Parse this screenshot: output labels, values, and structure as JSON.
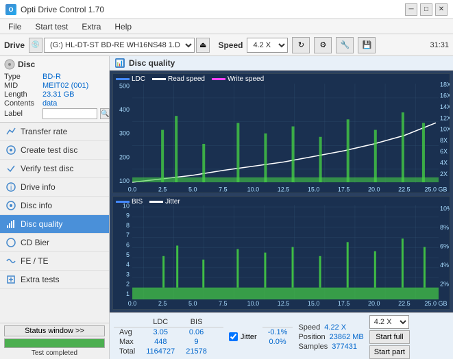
{
  "titlebar": {
    "title": "Opti Drive Control 1.70",
    "min": "─",
    "max": "□",
    "close": "✕"
  },
  "menu": {
    "items": [
      "File",
      "Start test",
      "Extra",
      "Help"
    ]
  },
  "toolbar": {
    "drive_label": "Drive",
    "drive_value": "(G:) HL-DT-ST BD-RE  WH16NS48 1.D3",
    "speed_label": "Speed",
    "speed_value": "4.2 X"
  },
  "disc": {
    "title": "Disc",
    "rows": [
      {
        "label": "Type",
        "value": "BD-R"
      },
      {
        "label": "MID",
        "value": "MEIT02 (001)"
      },
      {
        "label": "Length",
        "value": "23.31 GB"
      },
      {
        "label": "Contents",
        "value": "data"
      },
      {
        "label": "Label",
        "value": ""
      }
    ]
  },
  "nav": {
    "items": [
      {
        "id": "transfer-rate",
        "label": "Transfer rate",
        "icon": "chart"
      },
      {
        "id": "create-test-disc",
        "label": "Create test disc",
        "icon": "disc"
      },
      {
        "id": "verify-test-disc",
        "label": "Verify test disc",
        "icon": "check"
      },
      {
        "id": "drive-info",
        "label": "Drive info",
        "icon": "info"
      },
      {
        "id": "disc-info",
        "label": "Disc info",
        "icon": "disc2"
      },
      {
        "id": "disc-quality",
        "label": "Disc quality",
        "icon": "quality",
        "active": true
      },
      {
        "id": "cd-bier",
        "label": "CD Bier",
        "icon": "cd"
      },
      {
        "id": "fe-te",
        "label": "FE / TE",
        "icon": "wave"
      },
      {
        "id": "extra-tests",
        "label": "Extra tests",
        "icon": "extra"
      }
    ]
  },
  "status": {
    "button_label": "Status window >>",
    "progress": 100,
    "text": "Test completed"
  },
  "chart": {
    "title": "Disc quality",
    "legend1": {
      "ldc_label": "LDC",
      "read_label": "Read speed",
      "write_label": "Write speed"
    },
    "legend2": {
      "bis_label": "BIS",
      "jitter_label": "Jitter"
    },
    "yaxis1": [
      "500",
      "400",
      "300",
      "200",
      "100"
    ],
    "yaxis1_right": [
      "18X",
      "16X",
      "14X",
      "12X",
      "10X",
      "8X",
      "6X",
      "4X",
      "2X"
    ],
    "xaxis1": [
      "0.0",
      "2.5",
      "5.0",
      "7.5",
      "10.0",
      "12.5",
      "15.0",
      "17.5",
      "20.0",
      "22.5",
      "25.0 GB"
    ],
    "yaxis2": [
      "10",
      "9",
      "8",
      "7",
      "6",
      "5",
      "4",
      "3",
      "2",
      "1"
    ],
    "yaxis2_right": [
      "10%",
      "8%",
      "6%",
      "4%",
      "2%"
    ],
    "xaxis2": [
      "0.0",
      "2.5",
      "5.0",
      "7.5",
      "10.0",
      "12.5",
      "15.0",
      "17.5",
      "20.0",
      "22.5",
      "25.0 GB"
    ]
  },
  "stats": {
    "columns": [
      "LDC",
      "BIS",
      "",
      "Jitter",
      "Speed",
      ""
    ],
    "rows": [
      {
        "label": "Avg",
        "ldc": "3.05",
        "bis": "0.06",
        "jitter": "-0.1%",
        "speed_label": "Speed",
        "speed_val": "4.22 X"
      },
      {
        "label": "Max",
        "ldc": "448",
        "bis": "9",
        "jitter": "0.0%",
        "pos_label": "Position",
        "pos_val": "23862 MB"
      },
      {
        "label": "Total",
        "ldc": "1164727",
        "bis": "21578",
        "jitter": "",
        "samples_label": "Samples",
        "samples_val": "377431"
      }
    ],
    "speed_select": "4.2 X",
    "start_full": "Start full",
    "start_part": "Start part",
    "jitter_checked": true,
    "jitter_label": "Jitter"
  },
  "time": "31:31"
}
